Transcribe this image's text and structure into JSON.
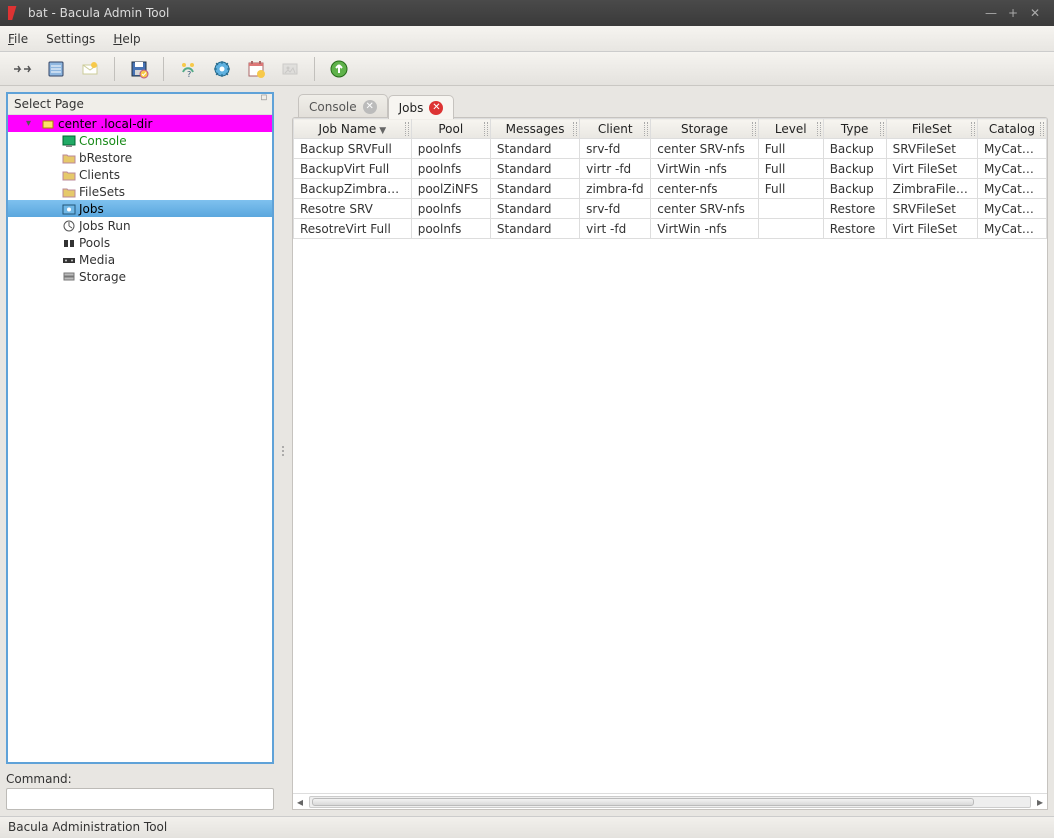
{
  "window": {
    "title": "bat - Bacula Admin Tool",
    "blurred_hint": "—"
  },
  "menu": {
    "file": "File",
    "settings": "Settings",
    "help": "Help"
  },
  "sidebar": {
    "header": "Select Page",
    "root": "center            .local-dir",
    "items": [
      {
        "label": "Console",
        "icon": "console-icon",
        "cls": "console-label"
      },
      {
        "label": "bRestore",
        "icon": "folder-icon"
      },
      {
        "label": "Clients",
        "icon": "folder-icon"
      },
      {
        "label": "FileSets",
        "icon": "folder-icon"
      },
      {
        "label": "Jobs",
        "icon": "jobs-icon",
        "selected": true
      },
      {
        "label": "Jobs Run",
        "icon": "run-icon"
      },
      {
        "label": "Pools",
        "icon": "pools-icon"
      },
      {
        "label": "Media",
        "icon": "media-icon"
      },
      {
        "label": "Storage",
        "icon": "storage-icon"
      }
    ]
  },
  "command": {
    "label": "Command:",
    "value": ""
  },
  "statusbar": "Bacula Administration Tool",
  "tabs": [
    {
      "label": "Console",
      "active": false,
      "close": "gray"
    },
    {
      "label": "Jobs",
      "active": true,
      "close": "red"
    }
  ],
  "table": {
    "columns": [
      "Job Name",
      "Pool",
      "Messages",
      "Client",
      "Storage",
      "Level",
      "Type",
      "FileSet",
      "Catalog"
    ],
    "sort_col": 0,
    "rows": [
      {
        "job": "Backup      SRVFull",
        "pool": "poolnfs",
        "msg": "Standard",
        "client": "       srv-fd",
        "storage": "center       SRV-nfs",
        "level": "Full",
        "type": "Backup",
        "fileset": "      SRVFileSet",
        "catalog": "MyCatalog"
      },
      {
        "job": "BackupVirt        Full",
        "pool": "poolnfs",
        "msg": "Standard",
        "client": "virtr        -fd",
        "storage": "VirtWin       -nfs",
        "level": "Full",
        "type": "Backup",
        "fileset": "Virt       FileSet",
        "catalog": "MyCatalog"
      },
      {
        "job": "BackupZimbraFull",
        "pool": "poolZiNFS",
        "msg": "Standard",
        "client": "zimbra-fd",
        "storage": "center-nfs",
        "level": "Full",
        "type": "Backup",
        "fileset": "ZimbraFileSet",
        "catalog": "MyCatalog"
      },
      {
        "job": "Resotre       SRV",
        "pool": "poolnfs",
        "msg": "Standard",
        "client": "       srv-fd",
        "storage": "center       SRV-nfs",
        "level": "",
        "type": "Restore",
        "fileset": "      SRVFileSet",
        "catalog": "MyCatalog"
      },
      {
        "job": "ResotreVirt        Full",
        "pool": "poolnfs",
        "msg": "Standard",
        "client": "virt        -fd",
        "storage": "VirtWin       -nfs",
        "level": "",
        "type": "Restore",
        "fileset": "Virt       FileSet",
        "catalog": "MyCatalog"
      }
    ]
  }
}
